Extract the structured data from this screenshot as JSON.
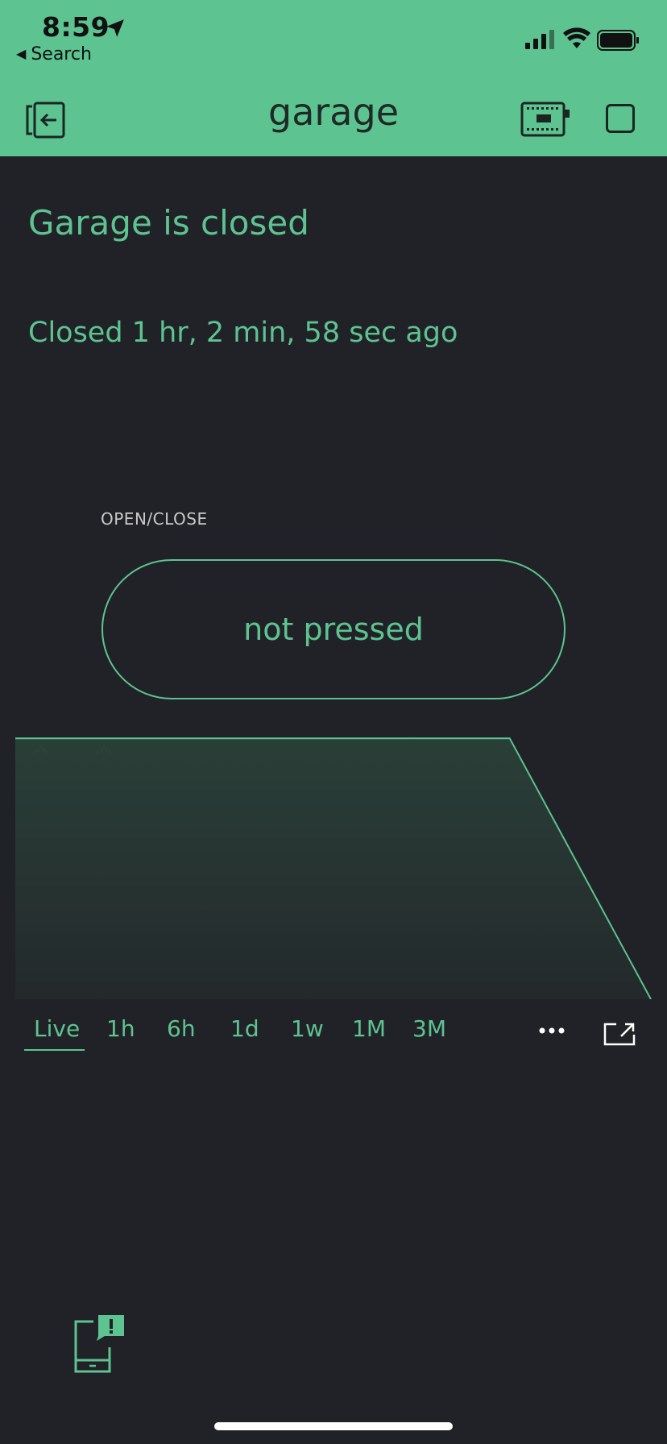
{
  "status_bar": {
    "time": "8:59",
    "back_label": "Search"
  },
  "header": {
    "title": "garage"
  },
  "widgets": {
    "status_label": "Garage is closed",
    "closed_duration": "Closed 1 hr, 2 min, 58 sec ago",
    "button_caption": "OPEN/CLOSE",
    "button_state": "not pressed"
  },
  "chart_data": {
    "type": "area",
    "title": "",
    "xlabel": "",
    "ylabel": "",
    "series": [
      {
        "values": [
          1,
          1,
          1,
          1,
          1,
          1,
          1,
          1,
          0.5,
          0
        ]
      }
    ],
    "x": [
      0,
      1,
      2,
      3,
      4,
      5,
      6,
      7,
      8,
      9
    ],
    "ylim": [
      0,
      1.05
    ],
    "grid": false,
    "legend": "none",
    "line_color": "#5DC391",
    "fill_color": "#2a3f38"
  },
  "range_tabs": {
    "items": [
      "Live",
      "1h",
      "6h",
      "1d",
      "1w",
      "1M",
      "3M"
    ],
    "selected": "Live"
  },
  "colors": {
    "accent": "#5DC391",
    "background": "#212227"
  },
  "icons": {
    "exit": "exit-icon",
    "device": "device-icon",
    "more": "more-icon",
    "expand": "expand-icon",
    "notification": "phone-notification-icon"
  }
}
